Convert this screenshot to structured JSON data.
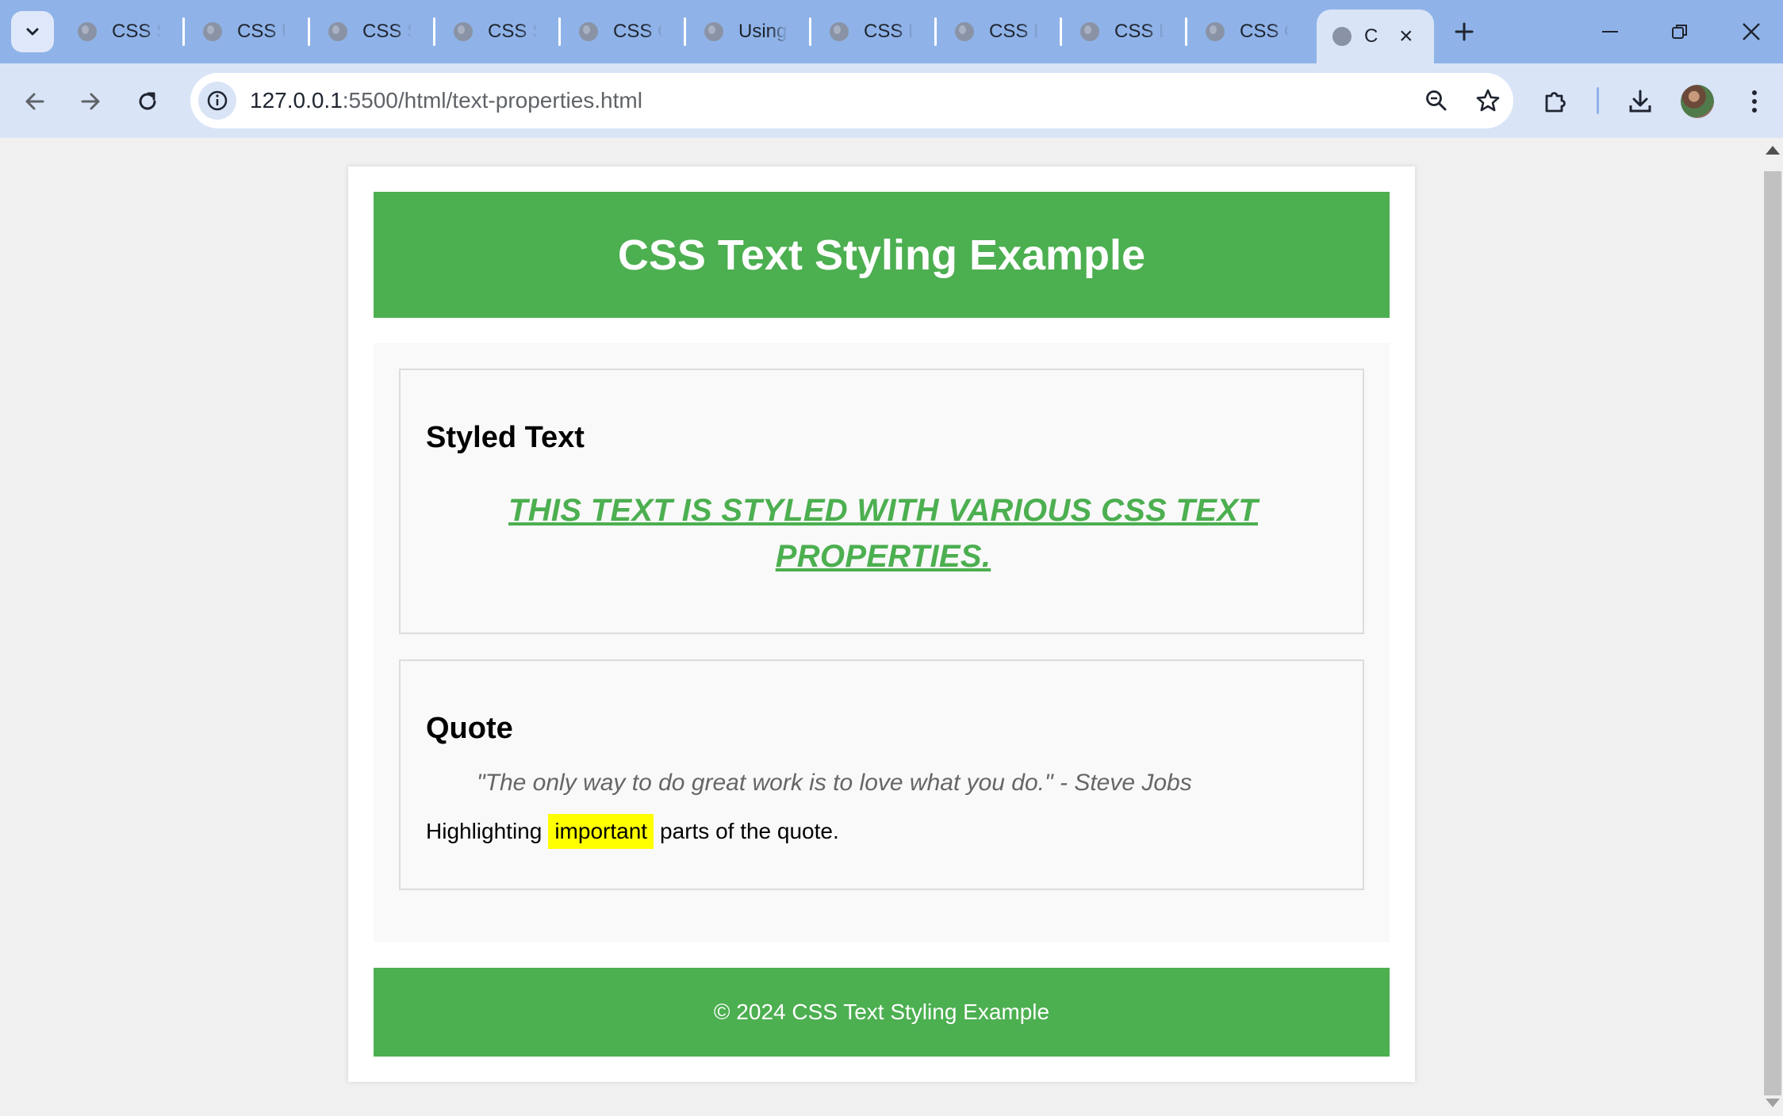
{
  "browser": {
    "tabs": [
      {
        "label": "CSS Sy"
      },
      {
        "label": "CSS U"
      },
      {
        "label": "CSS St"
      },
      {
        "label": "CSS Sc"
      },
      {
        "label": "CSS C"
      },
      {
        "label": "Using"
      },
      {
        "label": "CSS B"
      },
      {
        "label": "CSS Bo"
      },
      {
        "label": "CSS La"
      },
      {
        "label": "CSS O"
      }
    ],
    "active_tab": {
      "label": "C"
    },
    "url_host": "127.0.0.1",
    "url_rest": ":5500/html/text-properties.html",
    "icons": [
      "tab-search-icon",
      "globe-icon",
      "close-icon",
      "plus-icon",
      "minimize-icon",
      "restore-icon",
      "window-close-icon",
      "back-arrow-icon",
      "forward-arrow-icon",
      "reload-icon",
      "info-icon",
      "zoom-icon",
      "star-icon",
      "extensions-icon",
      "download-icon",
      "avatar",
      "more-vert-icon"
    ]
  },
  "page": {
    "header": {
      "title": "CSS Text Styling Example"
    },
    "styled_section": {
      "heading": "Styled Text",
      "text": "This text is styled with various CSS text properties."
    },
    "quote_section": {
      "heading": "Quote",
      "quote": "\"The only way to do great work is to love what you do.\" - Steve Jobs",
      "highlight_before": "Highlighting",
      "highlight_word": "important",
      "highlight_after": "parts of the quote."
    },
    "footer": {
      "text": "© 2024 CSS Text Styling Example"
    }
  },
  "colors": {
    "accent_green": "#4caf50",
    "highlight_yellow": "#ffff00",
    "tabbar_blue": "#8fb3e8",
    "toolbar_blue": "#d9e4f7"
  }
}
